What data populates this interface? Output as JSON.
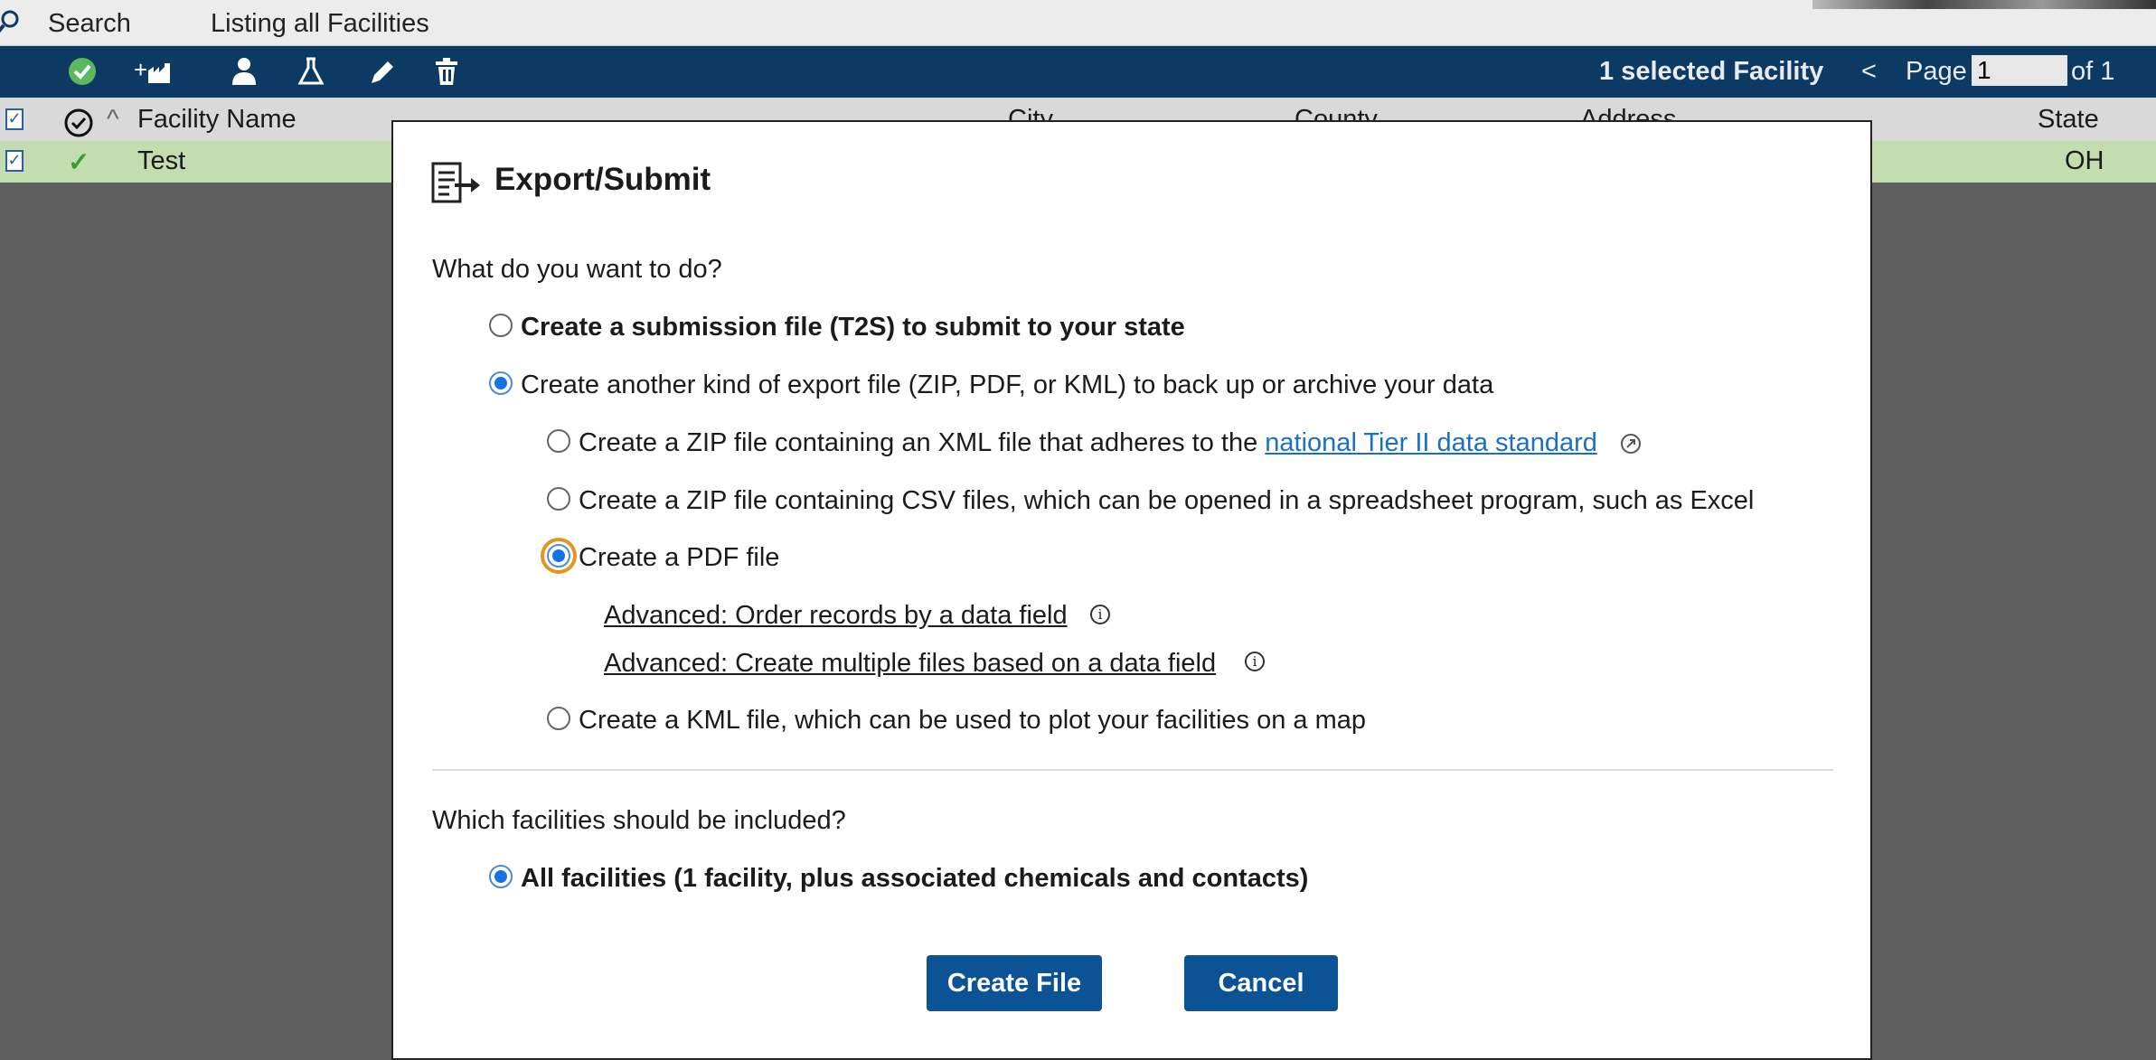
{
  "topbar": {
    "search_label": "Search",
    "listing_label": "Listing all Facilities"
  },
  "toolbar": {
    "icons": [
      "check-circle-icon",
      "add-facility-icon",
      "contact-icon",
      "chemical-flask-icon",
      "edit-pencil-icon",
      "trash-icon"
    ],
    "selection_text": "1 selected Facility",
    "prev_symbol": "<",
    "page_label": "Page",
    "page_value": "1",
    "of_label": "of 1"
  },
  "table": {
    "columns": [
      "Facility Name",
      "City",
      "County",
      "Address",
      "State"
    ],
    "rows": [
      {
        "status": "✓",
        "name": "Test",
        "state": "OH"
      }
    ]
  },
  "dialog": {
    "title": "Export/Submit",
    "question1": "What do you want to do?",
    "option_t2s": "Create a submission file (T2S) to submit to your state",
    "option_other": "Create another kind of export file (ZIP, PDF, or KML) to back up or archive your data",
    "option_zip_xml_prefix": "Create a ZIP file containing an XML file that adheres to the ",
    "option_zip_xml_link": "national Tier II data standard",
    "option_zip_csv": "Create a ZIP file containing CSV files, which can be opened in a spreadsheet program, such as Excel",
    "option_pdf": "Create a PDF file",
    "advanced_order": "Advanced: Order records by a data field",
    "advanced_multiple": "Advanced: Create multiple files based on a data field",
    "option_kml": "Create a KML file, which can be used to plot your facilities on a map",
    "question2": "Which facilities should be included?",
    "option_all": "All facilities (1 facility, plus associated chemicals and contacts)",
    "create_button": "Create File",
    "cancel_button": "Cancel"
  },
  "colors": {
    "toolbar_bg": "#0d3a63",
    "button_bg": "#0b5394",
    "link": "#1a6fc9",
    "row_selected": "#c4ddb0",
    "focus_ring": "#e5951c"
  }
}
